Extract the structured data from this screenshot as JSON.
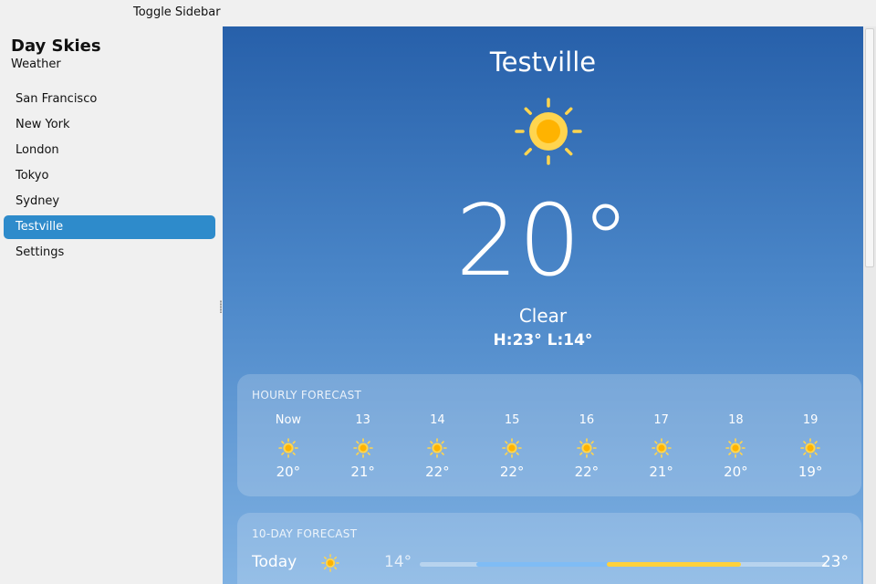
{
  "toolbar": {
    "toggle_sidebar_label": "Toggle Sidebar"
  },
  "sidebar": {
    "title": "Day Skies",
    "subtitle": "Weather",
    "items": [
      {
        "label": "San Francisco",
        "active": false
      },
      {
        "label": "New York",
        "active": false
      },
      {
        "label": "London",
        "active": false
      },
      {
        "label": "Tokyo",
        "active": false
      },
      {
        "label": "Sydney",
        "active": false
      },
      {
        "label": "Testville",
        "active": true
      },
      {
        "label": "Settings",
        "active": false
      }
    ],
    "active_color": "#2e8bcb"
  },
  "current": {
    "city": "Testville",
    "icon": "sun-icon",
    "temperature": "20°",
    "condition": "Clear",
    "high_low": "H:23° L:14°"
  },
  "hourly": {
    "title": "HOURLY FORECAST",
    "hours": [
      {
        "label": "Now",
        "icon": "sun-icon",
        "temp": "20°"
      },
      {
        "label": "13",
        "icon": "sun-icon",
        "temp": "21°"
      },
      {
        "label": "14",
        "icon": "sun-icon",
        "temp": "22°"
      },
      {
        "label": "15",
        "icon": "sun-icon",
        "temp": "22°"
      },
      {
        "label": "16",
        "icon": "sun-icon",
        "temp": "22°"
      },
      {
        "label": "17",
        "icon": "sun-icon",
        "temp": "21°"
      },
      {
        "label": "18",
        "icon": "sun-icon",
        "temp": "20°"
      },
      {
        "label": "19",
        "icon": "sun-icon",
        "temp": "19°"
      }
    ]
  },
  "daily": {
    "title": "10-DAY FORECAST",
    "days": [
      {
        "name": "Today",
        "icon": "sun-icon",
        "low": "14°",
        "high": "23°",
        "range_blue": [
          0.14,
          0.47
        ],
        "range_yellow": [
          0.46,
          0.79
        ]
      }
    ]
  },
  "colors": {
    "sun_core": "#ffb300",
    "sun_ring": "#ffd54f",
    "sun_rays": "#ffd54f",
    "range_blue": "#7fbcf5",
    "range_yellow": "#ffd13b"
  }
}
